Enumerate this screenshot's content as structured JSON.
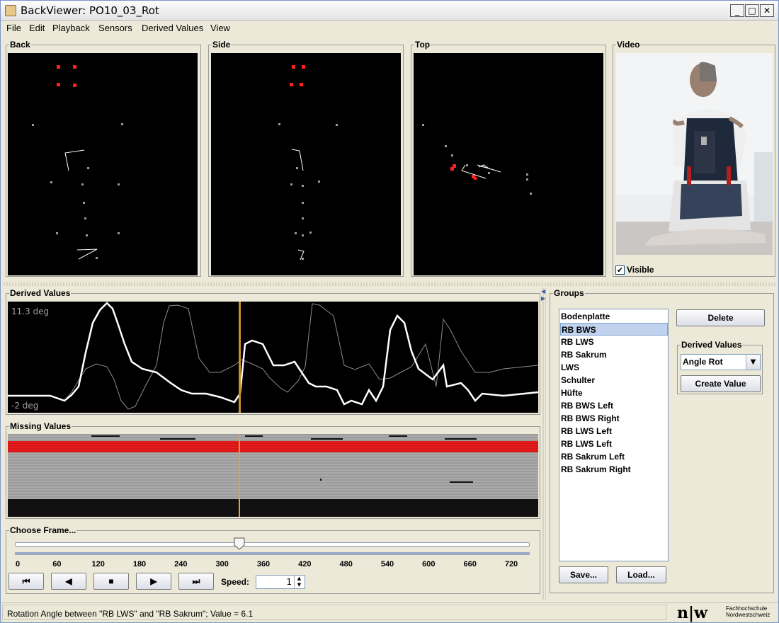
{
  "window": {
    "title": "BackViewer: PO10_03_Rot",
    "controls": {
      "minimize": "_",
      "maximize": "□",
      "close": "✕"
    }
  },
  "menu": {
    "items": [
      "File",
      "Edit",
      "Playback",
      "Sensors",
      "Derived Values",
      "View"
    ]
  },
  "views": {
    "back_label": "Back",
    "side_label": "Side",
    "top_label": "Top",
    "video_label": "Video"
  },
  "video": {
    "visible_label": "Visible",
    "visible_checked": true
  },
  "derived_panel": {
    "label": "Derived Values",
    "y_max_label": "11.3 deg",
    "y_min_label": "-2 deg",
    "frame_marker": 324
  },
  "missing_panel": {
    "label": "Missing Values"
  },
  "frame_panel": {
    "label": "Choose Frame...",
    "slider_value": 324,
    "slider_min": 0,
    "slider_max": 750,
    "ticks": [
      "0",
      "60",
      "120",
      "180",
      "240",
      "300",
      "360",
      "420",
      "480",
      "540",
      "600",
      "660",
      "720"
    ],
    "speed_label": "Speed:",
    "speed_value": "1",
    "buttons": {
      "to_start": "⏮",
      "back": "◀",
      "stop": "■",
      "play": "▶",
      "to_end": "⏭"
    }
  },
  "groups_panel": {
    "label": "Groups",
    "items": [
      "Bodenplatte",
      "RB BWS",
      "RB LWS",
      "RB Sakrum",
      "LWS",
      "Schulter",
      "Hüfte",
      "RB BWS Left",
      "RB BWS Right",
      "RB LWS Left",
      "RB LWS Left",
      "RB Sakrum Left",
      "RB Sakrum Right"
    ],
    "selected_index": 1,
    "delete_label": "Delete",
    "derived_values_label": "Derived Values",
    "dropdown_value": "Angle Rot",
    "create_label": "Create Value",
    "save_label": "Save...",
    "load_label": "Load..."
  },
  "status": {
    "text": "Rotation Angle between \"RB LWS\" and \"RB Sakrum\"; Value = 6.1",
    "logo_mark": "n|w",
    "logo_line1": "Fachhochschule",
    "logo_line2": "Nordwestschweiz"
  },
  "colors": {
    "accent_red": "#ff0000",
    "marker_orange": "#e8a030",
    "selection": "#c1d2ee"
  }
}
